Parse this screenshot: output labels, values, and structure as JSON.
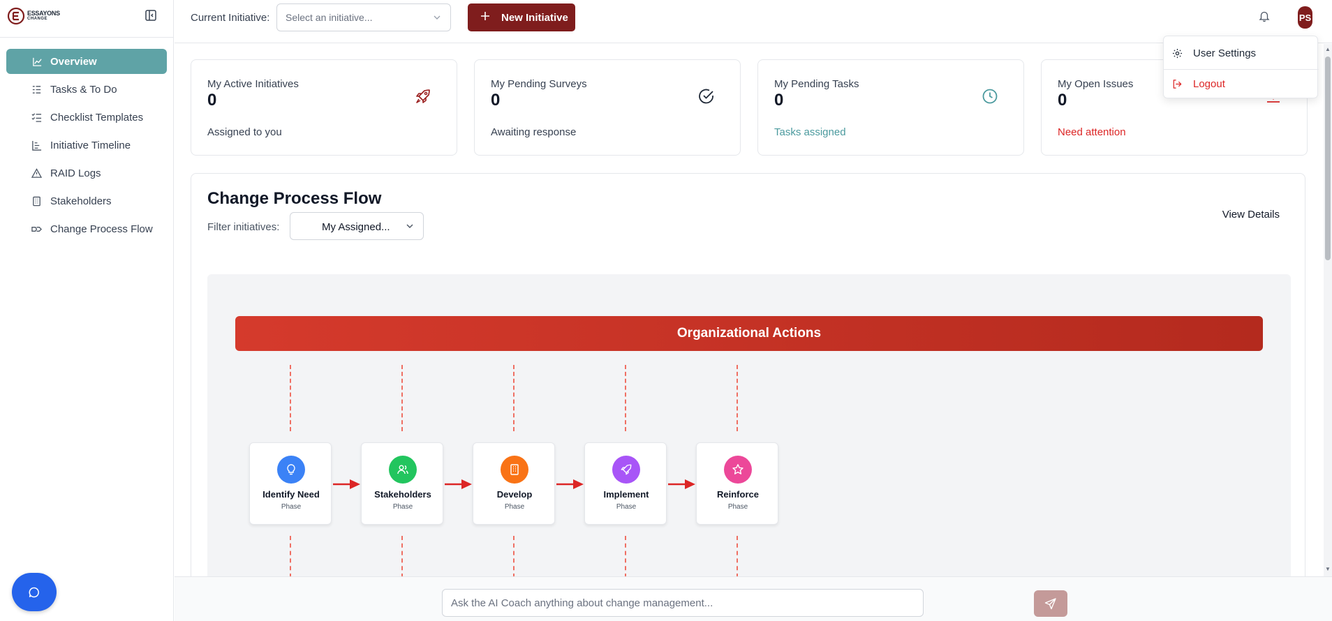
{
  "brand": {
    "line1": "ESSAYONS",
    "line2": "CHANGE",
    "accent": "#7f1d1d"
  },
  "sidebar": {
    "items": [
      {
        "label": "Overview",
        "icon": "line-chart-icon",
        "active": true
      },
      {
        "label": "Tasks & To Do",
        "icon": "list-icon"
      },
      {
        "label": "Checklist Templates",
        "icon": "checklist-icon"
      },
      {
        "label": "Initiative Timeline",
        "icon": "timeline-icon"
      },
      {
        "label": "RAID Logs",
        "icon": "warning-triangle-icon"
      },
      {
        "label": "Stakeholders",
        "icon": "building-icon"
      },
      {
        "label": "Change Process Flow",
        "icon": "workflow-icon"
      }
    ]
  },
  "topbar": {
    "current_initiative_label": "Current Initiative:",
    "initiative_placeholder": "Select an initiative...",
    "new_initiative_label": "New Initiative",
    "avatar_initials": "PS"
  },
  "user_menu": {
    "settings_label": "User Settings",
    "logout_label": "Logout"
  },
  "stats": [
    {
      "title": "My Active Initiatives",
      "value": "0",
      "subtitle": "Assigned to you",
      "icon": "rocket-icon",
      "tone": "default"
    },
    {
      "title": "My Pending Surveys",
      "value": "0",
      "subtitle": "Awaiting response",
      "icon": "check-circle-icon",
      "tone": "default"
    },
    {
      "title": "My Pending Tasks",
      "value": "0",
      "subtitle": "Tasks assigned",
      "icon": "clock-icon",
      "tone": "teal"
    },
    {
      "title": "My Open Issues",
      "value": "0",
      "subtitle": "Need attention",
      "icon": "alert-icon",
      "tone": "red"
    }
  ],
  "flow": {
    "title": "Change Process Flow",
    "filter_label": "Filter initiatives:",
    "filter_value": "My Assigned...",
    "view_details": "View Details",
    "banner": "Organizational Actions",
    "phases": [
      {
        "name": "Identify Need",
        "type": "Phase",
        "color": "#3b82f6",
        "icon": "lightbulb-icon"
      },
      {
        "name": "Stakeholders",
        "type": "Phase",
        "color": "#22c55e",
        "icon": "users-icon"
      },
      {
        "name": "Develop",
        "type": "Phase",
        "color": "#f97316",
        "icon": "building-icon"
      },
      {
        "name": "Implement",
        "type": "Phase",
        "color": "#a855f7",
        "icon": "rocket-icon"
      },
      {
        "name": "Reinforce",
        "type": "Phase",
        "color": "#ec4899",
        "icon": "star-icon"
      }
    ]
  },
  "ai_coach": {
    "placeholder": "Ask the AI Coach anything about change management..."
  }
}
